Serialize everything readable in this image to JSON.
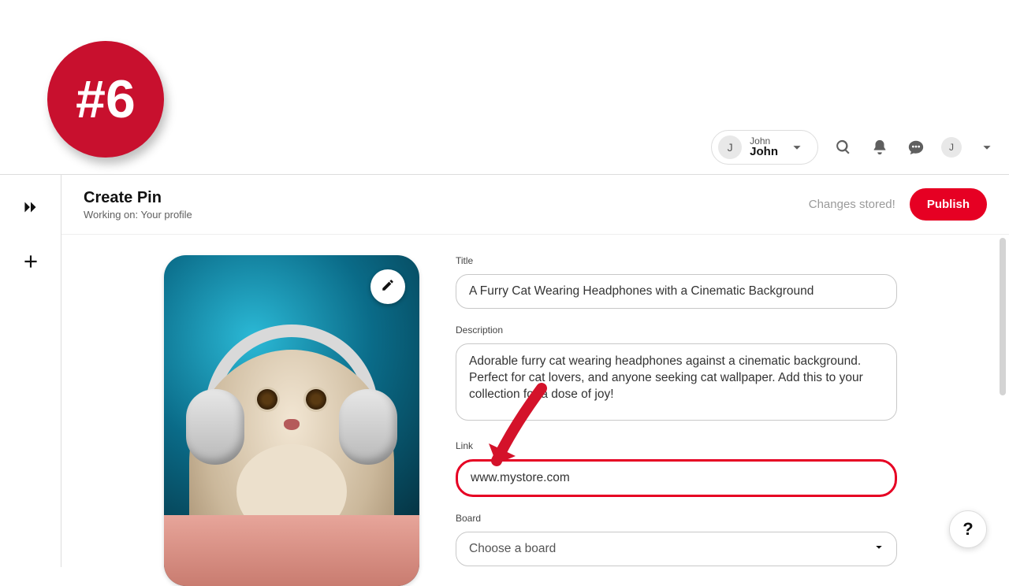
{
  "annotation": {
    "step_badge": "#6"
  },
  "nav": {
    "profile": {
      "initial": "J",
      "label_small": "John",
      "label_main": "John"
    },
    "avatar_initial": "J"
  },
  "page": {
    "title": "Create Pin",
    "subtitle": "Working on: Your profile",
    "status": "Changes stored!",
    "publish_label": "Publish",
    "help_label": "?"
  },
  "form": {
    "title_label": "Title",
    "title_value": "A Furry Cat Wearing Headphones with a Cinematic Background",
    "description_label": "Description",
    "description_value": "Adorable furry cat wearing headphones against a cinematic background. Perfect for cat lovers, and anyone seeking cat wallpaper. Add this to your collection for a dose of joy!",
    "link_label": "Link",
    "link_value": "www.mystore.com",
    "board_label": "Board",
    "board_placeholder": "Choose a board"
  }
}
